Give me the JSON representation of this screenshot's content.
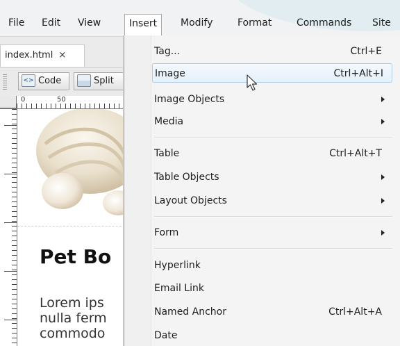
{
  "menubar": {
    "items": [
      "File",
      "Edit",
      "View",
      "Insert",
      "Modify",
      "Format",
      "Commands",
      "Site"
    ],
    "active_index": 3
  },
  "document": {
    "tab_label": "index.html",
    "tab_close": "×"
  },
  "toolbar": {
    "code_label": "Code",
    "split_label": "Split"
  },
  "ruler": {
    "label_0": "0",
    "label_50": "50"
  },
  "canvas": {
    "heading": "Pet Bo",
    "para_lines": [
      "Lorem ips",
      "nulla ferm",
      "commodo"
    ]
  },
  "insert_menu": {
    "items": [
      {
        "label": "Tag...",
        "shortcut": "Ctrl+E"
      },
      {
        "label": "Image",
        "shortcut": "Ctrl+Alt+I"
      },
      {
        "label": "Image Objects",
        "shortcut": ""
      },
      {
        "label": "Media",
        "shortcut": ""
      },
      {
        "label": "Table",
        "shortcut": "Ctrl+Alt+T"
      },
      {
        "label": "Table Objects",
        "shortcut": ""
      },
      {
        "label": "Layout Objects",
        "shortcut": ""
      },
      {
        "label": "Form",
        "shortcut": ""
      },
      {
        "label": "Hyperlink",
        "shortcut": ""
      },
      {
        "label": "Email Link",
        "shortcut": ""
      },
      {
        "label": "Named Anchor",
        "shortcut": "Ctrl+Alt+A"
      },
      {
        "label": "Date",
        "shortcut": ""
      }
    ],
    "highlighted": "Image"
  },
  "icons": {
    "cursor": "mouse-pointer-icon",
    "submenu": "submenu-arrow-icon",
    "code_view": "code-view-icon",
    "split_view": "split-view-icon"
  },
  "colors": {
    "highlight_border": "#aecdea",
    "highlight_fill": "#e5f0fa",
    "heading_text": "#111111"
  }
}
